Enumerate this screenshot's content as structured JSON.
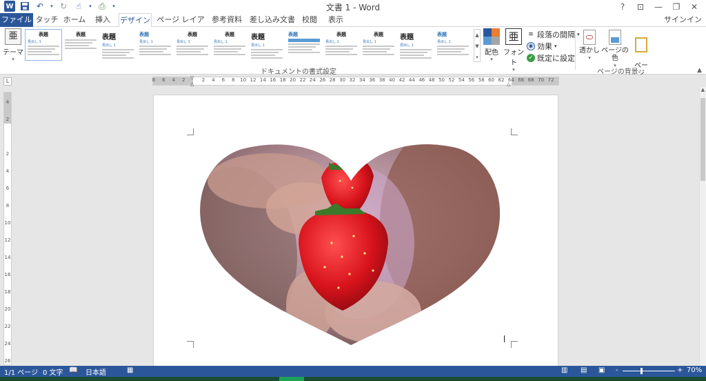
{
  "app": {
    "title": "文書 1 - Word",
    "signin": "サインイン"
  },
  "tabs": [
    {
      "label": "ファイル"
    },
    {
      "label": "タッチ"
    },
    {
      "label": "ホーム"
    },
    {
      "label": "挿入"
    },
    {
      "label": "デザイン"
    },
    {
      "label": "ページ レイアウト"
    },
    {
      "label": "参考資料"
    },
    {
      "label": "差し込み文書"
    },
    {
      "label": "校閲"
    },
    {
      "label": "表示"
    }
  ],
  "active_tab": "デザイン",
  "ribbon": {
    "theme_label": "テーマ",
    "theme_icon_char": "亜",
    "styles_group_label": "ドキュメントの書式設定",
    "style_thumbs": [
      {
        "title": "表題",
        "heading": "見出し 1"
      },
      {
        "title": "表題",
        "heading": ""
      },
      {
        "title": "表題",
        "heading": "見出し 1"
      },
      {
        "title": "表題",
        "heading": "見出し 1"
      },
      {
        "title": "表題",
        "heading": "見出し 1"
      },
      {
        "title": "表題",
        "heading": "見出し 1"
      },
      {
        "title": "表題",
        "heading": "見出し 1"
      },
      {
        "title": "表題",
        "heading": ""
      },
      {
        "title": "表題",
        "heading": "見出し 1"
      },
      {
        "title": "表題",
        "heading": "見出し 1"
      },
      {
        "title": "表題",
        "heading": "見出し 1"
      },
      {
        "title": "表題",
        "heading": "見出し 1"
      }
    ],
    "colors_label": "配色",
    "fonts_label": "フォント",
    "fonts_icon_char": "亜",
    "paragraph_spacing": "段落の間隔",
    "effects": "効果",
    "set_default": "既定に設定",
    "watermark": "透かし",
    "page_color": "ページの色",
    "page_borders": "ページ\n罫線",
    "page_bg_group_label": "ページの背景"
  },
  "ruler": {
    "h_labels": [
      "8",
      "6",
      "4",
      "2",
      "",
      "2",
      "4",
      "6",
      "8",
      "10",
      "12",
      "14",
      "16",
      "18",
      "20",
      "22",
      "24",
      "26",
      "28",
      "30",
      "32",
      "34",
      "36",
      "38",
      "40",
      "42",
      "44",
      "46",
      "48",
      "50",
      "52",
      "54",
      "56",
      "58",
      "60",
      "62",
      "64",
      "66",
      "68",
      "70",
      "72"
    ],
    "v_labels": [
      "4",
      "2",
      "",
      "2",
      "4",
      "6",
      "8",
      "10",
      "12",
      "14",
      "16",
      "18",
      "20",
      "22",
      "24",
      "26"
    ]
  },
  "statusbar": {
    "page": "1/1 ページ",
    "words": "0 文字",
    "language": "日本語",
    "zoom": "70%",
    "zoom_minus": "-",
    "zoom_plus": "+"
  },
  "colors": {
    "accent": "#2b579a",
    "heading_blue": "#2e74b5"
  },
  "document": {
    "image_subject": "heart-shaped photo of stacked strawberries"
  }
}
